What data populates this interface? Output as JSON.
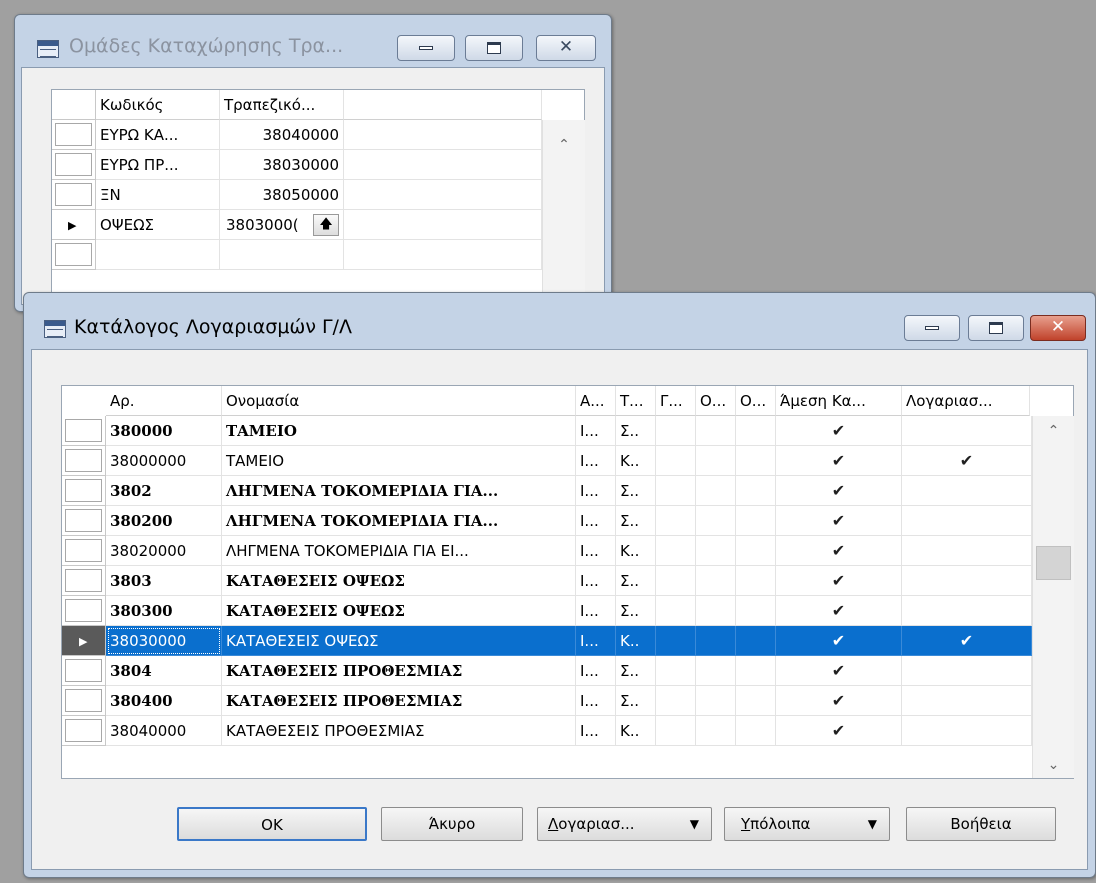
{
  "back_window": {
    "title": "Ομάδες Καταχώρησης Τρα...",
    "columns": [
      "Κωδικός",
      "Τραπεζικό..."
    ],
    "rows": [
      {
        "code": "ΕΥΡΩ ΚΑ...",
        "account": "38040000",
        "current": false
      },
      {
        "code": "ΕΥΡΩ ΠΡ...",
        "account": "38030000",
        "current": false
      },
      {
        "code": "ΞΝ",
        "account": "38050000",
        "current": false
      },
      {
        "code": "ΟΨΕΩΣ",
        "account": "3803000(",
        "current": true
      },
      {
        "code": "",
        "account": "",
        "current": false
      }
    ],
    "lookup_glyph": "🡅"
  },
  "front_window": {
    "title": "Κατάλογος Λογαριασμών Γ/Λ",
    "columns": [
      "Αρ.",
      "Ονομασία",
      "Α...",
      "Τ...",
      "Γ...",
      "Ο...",
      "Ο...",
      "Άμεση Κα...",
      "Λογαριασ..."
    ],
    "rows": [
      {
        "no": "380000",
        "name": "ΤΑΜΕΙΟ",
        "a": "Ι...",
        "t": "Σ..",
        "direct": "✔",
        "acct": "",
        "bold": true
      },
      {
        "no": "38000000",
        "name": "ΤΑΜΕΙΟ",
        "a": "Ι...",
        "t": "Κ..",
        "direct": "✔",
        "acct": "✔",
        "bold": false
      },
      {
        "no": "3802",
        "name": "ΛΗΓΜΕΝΑ ΤΟΚΟΜΕΡΙΔΙΑ ΓΙΑ...",
        "a": "Ι...",
        "t": "Σ..",
        "direct": "✔",
        "acct": "",
        "bold": true
      },
      {
        "no": "380200",
        "name": "ΛΗΓΜΕΝΑ ΤΟΚΟΜΕΡΙΔΙΑ ΓΙΑ...",
        "a": "Ι...",
        "t": "Σ..",
        "direct": "✔",
        "acct": "",
        "bold": true
      },
      {
        "no": "38020000",
        "name": "ΛΗΓΜΕΝΑ ΤΟΚΟΜΕΡΙΔΙΑ ΓΙΑ ΕΙ...",
        "a": "Ι...",
        "t": "Κ..",
        "direct": "✔",
        "acct": "",
        "bold": false
      },
      {
        "no": "3803",
        "name": "ΚΑΤΑΘΕΣΕΙΣ ΟΨΕΩΣ",
        "a": "Ι...",
        "t": "Σ..",
        "direct": "✔",
        "acct": "",
        "bold": true
      },
      {
        "no": "380300",
        "name": "ΚΑΤΑΘΕΣΕΙΣ ΟΨΕΩΣ",
        "a": "Ι...",
        "t": "Σ..",
        "direct": "✔",
        "acct": "",
        "bold": true
      },
      {
        "no": "38030000",
        "name": "ΚΑΤΑΘΕΣΕΙΣ ΟΨΕΩΣ",
        "a": "Ι...",
        "t": "Κ..",
        "direct": "✔",
        "acct": "✔",
        "bold": false,
        "selected": true
      },
      {
        "no": "3804",
        "name": "ΚΑΤΑΘΕΣΕΙΣ ΠΡΟΘΕΣΜΙΑΣ",
        "a": "Ι...",
        "t": "Σ..",
        "direct": "✔",
        "acct": "",
        "bold": true
      },
      {
        "no": "380400",
        "name": "ΚΑΤΑΘΕΣΕΙΣ ΠΡΟΘΕΣΜΙΑΣ",
        "a": "Ι...",
        "t": "Σ..",
        "direct": "✔",
        "acct": "",
        "bold": true
      },
      {
        "no": "38040000",
        "name": "ΚΑΤΑΘΕΣΕΙΣ ΠΡΟΘΕΣΜΙΑΣ",
        "a": "Ι...",
        "t": "Κ..",
        "direct": "✔",
        "acct": "",
        "bold": false
      }
    ],
    "buttons": {
      "ok": "OK",
      "cancel": "Άκυρο",
      "account_first": "Λ",
      "account_rest": "ογαριασ...",
      "balance_first": "Υ",
      "balance_rest": "πόλοιπα",
      "help": "Βοήθεια"
    }
  },
  "glyphs": {
    "row_pointer": "▶",
    "scroll_up": "⌃",
    "scroll_down": "⌄",
    "dropdown": "▼",
    "minimize": "minimize-icon",
    "maximize": "maximize-icon",
    "close": "✕"
  },
  "colors": {
    "selection": "#0a6fce",
    "desktop": "#a0a0a0",
    "close_button": "#c0422b"
  }
}
